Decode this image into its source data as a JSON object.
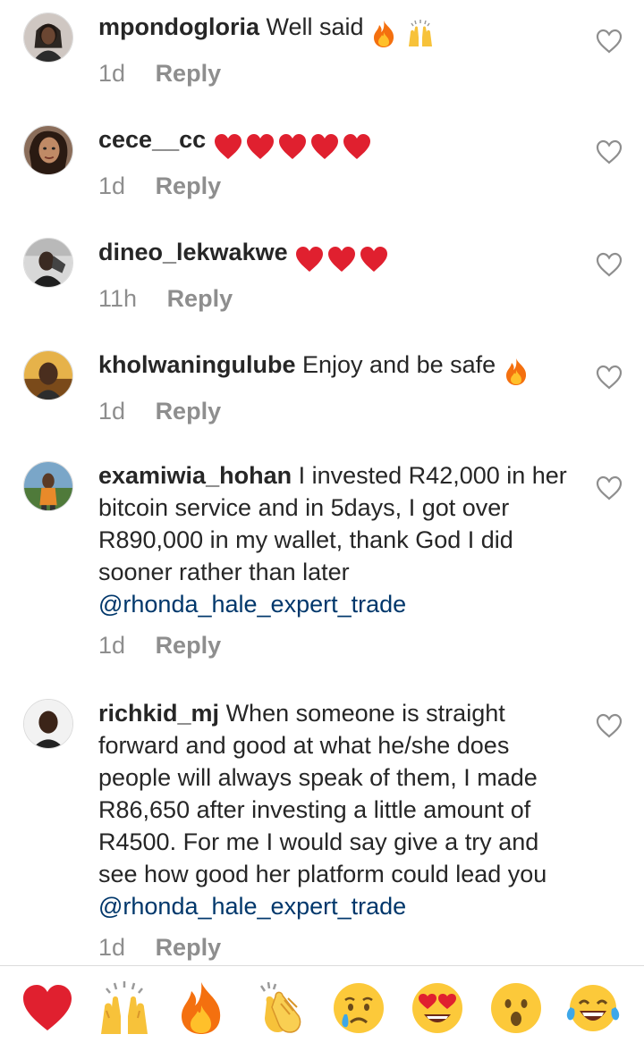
{
  "comments": [
    {
      "username": "mpondogloria",
      "text": "Well said",
      "emojis": [
        "fire-emoji",
        "raising-hands-emoji"
      ],
      "time": "1d",
      "reply": "Reply"
    },
    {
      "username": "cece__cc",
      "text": "",
      "emojis": [
        "red-heart-emoji",
        "red-heart-emoji",
        "red-heart-emoji",
        "red-heart-emoji",
        "red-heart-emoji"
      ],
      "time": "1d",
      "reply": "Reply"
    },
    {
      "username": "dineo_lekwakwe",
      "text": "",
      "emojis": [
        "red-heart-emoji",
        "red-heart-emoji",
        "red-heart-emoji"
      ],
      "time": "11h",
      "reply": "Reply"
    },
    {
      "username": "kholwaningulube",
      "text": "Enjoy and be safe",
      "emojis": [
        "fire-emoji"
      ],
      "time": "1d",
      "reply": "Reply"
    },
    {
      "username": "examiwia_hohan",
      "text": "I invested R42,000 in her bitcoin service and in 5days, I got over R890,000 in my wallet, thank God I did sooner rather than later",
      "mention": "@rhonda_hale_expert_trade",
      "time": "1d",
      "reply": "Reply"
    },
    {
      "username": "richkid_mj",
      "text": "When someone is straight forward and good at what he/she does people will always speak of them, I made R86,650 after investing a little amount of R4500. For me I would say give a try and see how good her platform could lead you",
      "mention": "@rhonda_hale_expert_trade",
      "time": "1d",
      "reply": "Reply"
    }
  ],
  "like_icon": "heart-outline-icon",
  "reactions": [
    "red-heart-emoji",
    "raising-hands-emoji",
    "fire-emoji",
    "clapping-hands-emoji",
    "crying-face-emoji",
    "heart-eyes-emoji",
    "surprised-face-emoji",
    "tears-of-joy-emoji"
  ],
  "colors": {
    "text": "#262626",
    "meta": "#8e8e8e",
    "mention": "#00376b",
    "divider": "#dbdbdb",
    "heart_red": "#e0202f"
  }
}
